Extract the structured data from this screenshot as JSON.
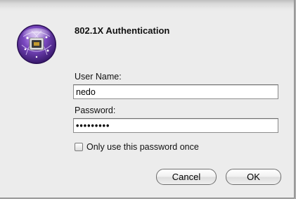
{
  "dialog": {
    "title": "802.1X Authentication",
    "icon": "network-lock-icon"
  },
  "form": {
    "username_label": "User Name:",
    "username_value": "nedo",
    "password_label": "Password:",
    "password_value": "•••••••••",
    "checkbox_label": "Only use this password once",
    "checkbox_checked": false
  },
  "buttons": {
    "cancel_label": "Cancel",
    "ok_label": "OK"
  },
  "colors": {
    "icon_purple": "#6a3fa6",
    "window_bg": "#ececec"
  }
}
